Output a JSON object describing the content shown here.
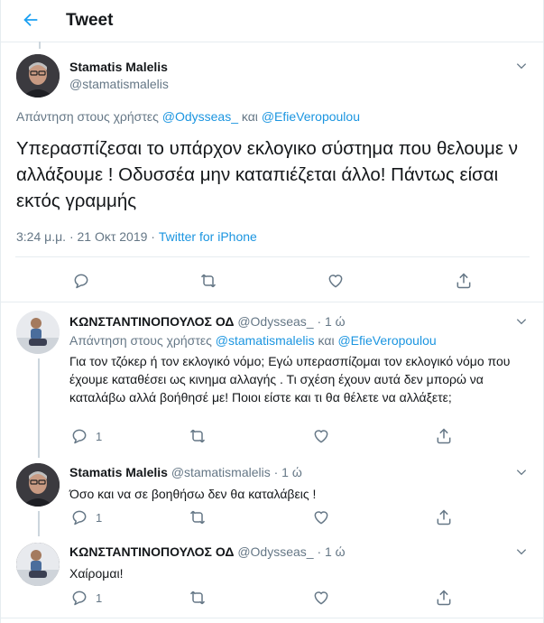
{
  "header": {
    "title": "Tweet"
  },
  "main_tweet": {
    "author_name": "Stamatis Malelis",
    "handle": "@stamatismalelis",
    "reply_prefix": "Απάντηση στους χρήστες",
    "mention1": "@Odysseas_",
    "conj": "και",
    "mention2": "@EfieVeropoulou",
    "text": "Υπερασπίζεσαι το υπάρχον εκλογικο σύστημα που θελουμε ν αλλάξουμε ! Οδυσσέα μην καταπιέζεται άλλο! Πάντως είσαι εκτός γραμμής",
    "time": "3:24 μ.μ. · 21 Οκτ 2019 ·",
    "source": "Twitter for iPhone"
  },
  "replies": [
    {
      "author_name": "ΚΩΝΣΤΑΝΤΙΝΟΠΟΥΛΟΣ ΟΔ",
      "handle": "@Odysseas_",
      "age": "· 1 ώ",
      "reply_prefix": "Απάντηση στους χρήστες",
      "mention1": "@stamatismalelis",
      "conj": "και",
      "mention2": "@EfieVeropoulou",
      "text": "Για τον τζόκερ ή τον εκλογικό νόμο; Εγώ υπερασπίζομαι τον εκλογικό νόμο που έχουμε καταθέσει ως κινημα αλλαγής . Τι σχέση έχουν αυτά δεν μπορώ να καταλάβω αλλά βοήθησέ με! Ποιοι είστε και τι θα θέλετε να αλλάξετε;",
      "reply_count": "1"
    },
    {
      "author_name": "Stamatis Malelis",
      "handle": "@stamatismalelis",
      "age": "· 1 ώ",
      "text": "Όσο και να σε βοηθήσω δεν θα καταλάβεις !",
      "reply_count": "1"
    },
    {
      "author_name": "ΚΩΝΣΤΑΝΤΙΝΟΠΟΥΛΟΣ ΟΔ",
      "handle": "@Odysseas_",
      "age": "· 1 ώ",
      "text": "Χαίρομαι!",
      "reply_count": "1"
    }
  ],
  "icons": {
    "back": "arrow-left-icon",
    "reply": "reply-bubble-icon",
    "retweet": "retweet-icon",
    "like": "heart-icon",
    "share": "share-icon",
    "more": "chevron-down-icon"
  },
  "colors": {
    "accent": "#1da1f2",
    "link": "#1b95e0",
    "muted": "#657786",
    "border": "#e6ecf0"
  }
}
